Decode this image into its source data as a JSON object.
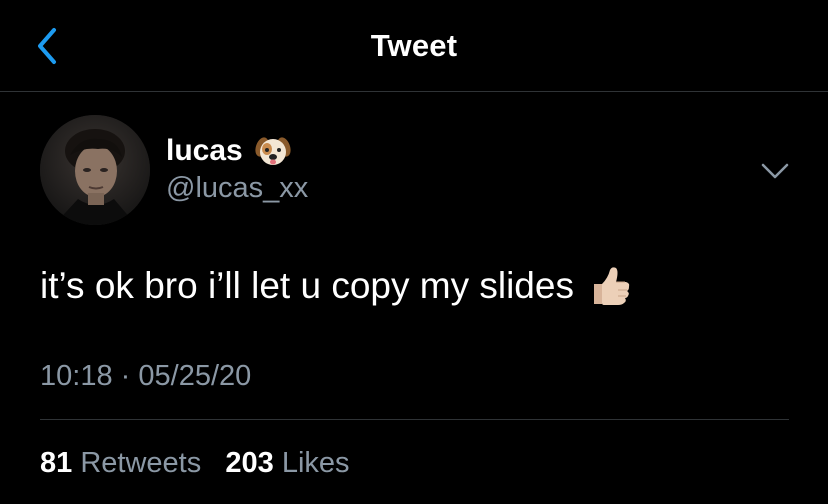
{
  "header": {
    "title": "Tweet",
    "back_icon": "chevron-left-icon",
    "accent_color": "#1d9bf0"
  },
  "tweet": {
    "author": {
      "display_name": "lucas",
      "name_emoji": "dog-face-icon",
      "handle": "@lucas_xx"
    },
    "text": "it’s ok bro i’ll let u copy my slides",
    "text_emoji": "thumbs-up-icon",
    "time": "10:18",
    "separator": "·",
    "date": "05/25/20",
    "stats": {
      "retweets_count": "81",
      "retweets_label": "Retweets",
      "likes_count": "203",
      "likes_label": "Likes"
    }
  },
  "colors": {
    "background": "#000000",
    "primary_text": "#ffffff",
    "secondary_text": "#8b98a5",
    "divider": "#2f3336"
  }
}
